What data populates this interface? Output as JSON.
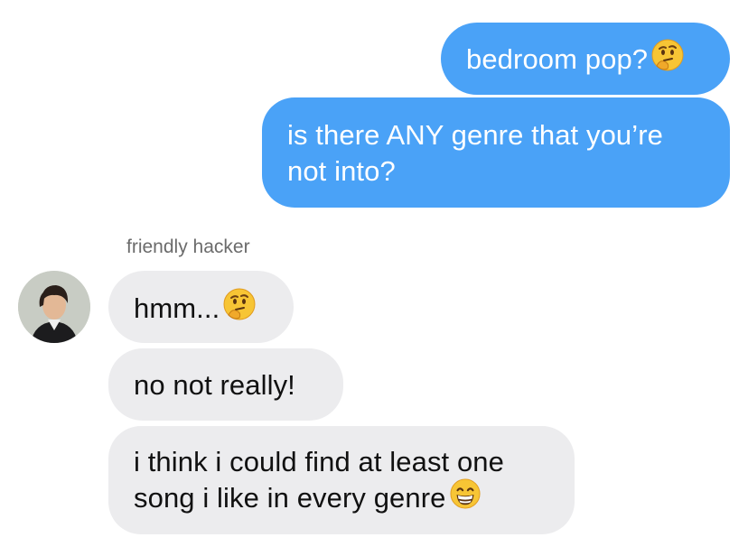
{
  "colors": {
    "outgoing_bubble": "#4aa2f7",
    "incoming_bubble": "#ececee",
    "outgoing_text": "#ffffff",
    "incoming_text": "#111111",
    "sender_label": "#6b6b6b"
  },
  "outgoing": [
    {
      "text": "bedroom pop?",
      "emoji": "thinking-face-emoji"
    },
    {
      "line1": "is there ANY genre that you’re",
      "line2": "not into?"
    }
  ],
  "incoming": {
    "sender": "friendly hacker",
    "avatar": "avatar-photo",
    "messages": [
      {
        "text": "hmm...",
        "emoji": "thinking-face-emoji"
      },
      {
        "text": "no not really!"
      },
      {
        "line1": "i think i could find at least one",
        "line2": "song i like in every genre",
        "emoji": "grinning-face-emoji"
      }
    ]
  }
}
